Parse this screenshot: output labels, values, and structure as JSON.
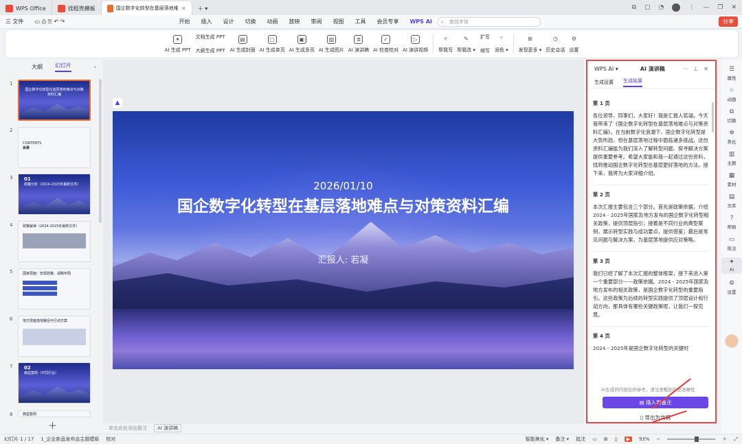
{
  "tabs": [
    {
      "label": "WPS Office",
      "color": "#e84d3c"
    },
    {
      "label": "找稻壳模板",
      "color": "#e84d3c"
    },
    {
      "label": "国企数字化转型在基层落地难点与…",
      "color": "#e86b32"
    }
  ],
  "menu": {
    "file": "三 文件",
    "items": [
      "开始",
      "插入",
      "设计",
      "切换",
      "动画",
      "放映",
      "审阅",
      "视图",
      "工具",
      "会员专享"
    ],
    "wpsai": "WPS AI",
    "search_placeholder": "查找字体",
    "share": "分享"
  },
  "ribbon": {
    "btn1": "AI 生成 PPT",
    "col1": [
      "文档生成 PPT",
      "大纲生成 PPT"
    ],
    "btns": [
      "AI 生成封面",
      "AI 生成单页",
      "AI 生成多页",
      "AI 生成图片",
      "AI 演讲稿",
      "AI 检查校对",
      "AI 演讲视频"
    ],
    "btns2": [
      "帮我写",
      "帮我改 ▾"
    ],
    "col2": [
      "扩写",
      "缩写"
    ],
    "btn_color": "润色 ▾",
    "btns3": [
      "发现更多 ▾",
      "历史会话",
      "设置"
    ]
  },
  "panel": {
    "tab_outline": "大纲",
    "tab_slides": "幻灯片",
    "slide_numbers": [
      "1",
      "2",
      "3",
      "4",
      "5",
      "6",
      "7",
      "8"
    ],
    "t1": "国企数字化转型在基层落地难点与对策资料汇编",
    "t2a": "CONTENTS",
    "t2b": "目录",
    "t3a": "01",
    "t3b": "政策分析（2024-2025年最新文件）",
    "t4": "政策解读（2024-2025年最新文件）",
    "t5": "国家层面：宏观政策、战略布局",
    "t6": "地方层面落地路径与行动方案",
    "t7a": "02",
    "t7b": "典型案例（不同行业）",
    "t8": "典型案例"
  },
  "slide": {
    "date": "2026/01/10",
    "title": "国企数字化转型在基层落地难点与对策资料汇编",
    "reporter": "汇报人: 若凝"
  },
  "notes": {
    "placeholder": "单击此处添加备注",
    "ai": "AI 演讲稿"
  },
  "ai": {
    "brand": "WPS AI ▾",
    "title": "AI 演讲稿",
    "sub_settings": "生成设置",
    "sub_result": "生成结果",
    "pages": [
      {
        "h": "第 1 页",
        "p": "各位领导、同事们，大家好！我是汇报人若凝。今天我带来了《国企数字化转型在基层落地难点与对策资料汇编》。在当前数字化浪潮下，国企数字化转型是大势所趋，但在基层落地过程中面临诸多挑战。这份资料汇编能为我们深入了解转型问题、探寻解决方案提供重要参考。希望大家能和我一起通过这份资料，找到推动国企数字化转型在基层更好落地的方法。接下来，我将为大家详细介绍。"
      },
      {
        "h": "第 2 页",
        "p": "本次汇报主要包含三个部分。首先是政策依据，介绍2024 - 2025年国家及地方发布的国企数字化转型相关政策，提供顶层指引；接着是不同行业的典型案例，展示转型实践与成功要点，提供借鉴；最后是常见问题与解决方案，为基层落地提供应对策略。"
      },
      {
        "h": "第 3 页",
        "p": "我们已经了解了本次汇报的整体框架，接下来进入第一个重要部分——政策依据。2024 - 2025年国家及地方发布的相关政策，是国企数字化转型的重要指引。这些政策为后续的转型实践提供了顶层设计和行动方向，那具体有哪些关键政策呢，让我们一探究竟。"
      },
      {
        "h": "第 4 页",
        "p": "2024 - 2025年是国企数字化转型的关键时"
      }
    ],
    "disclaimer": "AI生成的内容仅供参考，请注意甄别信息准确性",
    "insert": "插入到备注",
    "export": "导出为文稿"
  },
  "rightbar": [
    "属性",
    "动画",
    "切换",
    "美化",
    "主题",
    "素材",
    "文库",
    "帮助",
    "批注",
    "AI",
    "设置"
  ],
  "status": {
    "slide": "幻灯片 1 / 17",
    "template": "1_企业新品发布会主题模板",
    "proof": "校对",
    "beautify": "智能美化 ▾",
    "notes": "备注 ▾",
    "comments": "批注",
    "zoom": "93%"
  }
}
